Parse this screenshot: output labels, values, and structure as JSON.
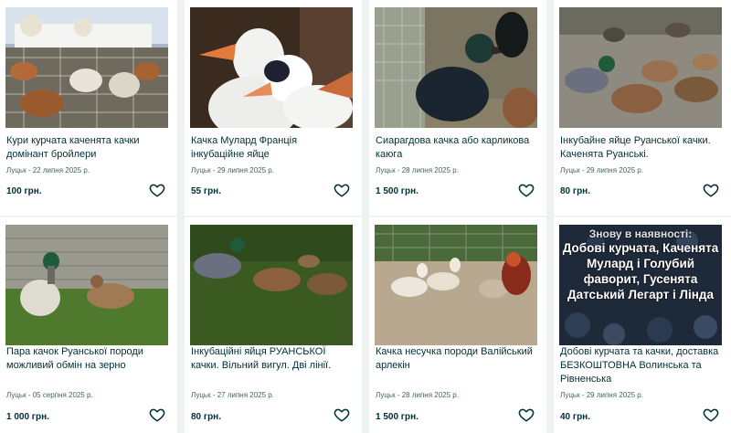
{
  "listings": [
    {
      "title": "Кури курчата каченята качки домінант бройлери",
      "location": "Луцьк",
      "date": "22 липня 2025 р.",
      "price": "100 грн.",
      "image": "chickens-in-cage-photo"
    },
    {
      "title": "Качка Мулард Франція інкубаційне яйце",
      "location": "Луцьк",
      "date": "29 липня 2025 р.",
      "price": "55 грн.",
      "image": "white-mulard-ducks-photo"
    },
    {
      "title": "Сиарагдова качка або карликова каюга",
      "location": "Луцьк",
      "date": "28 липня 2025 р.",
      "price": "1 500 грн.",
      "image": "emerald-duck-photo"
    },
    {
      "title": "Інкубайне яйце Руанської качки. Каченята Руанські.",
      "location": "Луцьк",
      "date": "29 липня 2025 р.",
      "price": "80 грн.",
      "image": "rouen-ducks-flock-photo"
    },
    {
      "title": "Пара качок Руанської породи можливий обмін на зерно",
      "location": "Луцьк",
      "date": "05 серпня 2025 р.",
      "price": "1 000 грн.",
      "image": "rouen-duck-pair-photo"
    },
    {
      "title": "Інкубаційні яйця РУАНСЬКОЇ качки. Вільний вигул. Дві лінії.",
      "location": "Луцьк",
      "date": "27 липня 2025 р.",
      "price": "80 грн.",
      "image": "ducks-on-grass-photo"
    },
    {
      "title": "Качка несучка породи Валійський арлекін",
      "location": "Луцьк",
      "date": "28 липня 2025 р.",
      "price": "1 500 грн.",
      "image": "welsh-harlequin-ducks-photo"
    },
    {
      "title": "Добові курчата та качки, доставка БЕЗКОШТОВНА Волинська та Рівненська",
      "location": "Луцьк",
      "date": "29 липня 2025 р.",
      "price": "40 грн.",
      "image": "promo-banner-photo",
      "image_text": {
        "top": "Знову в наявності:",
        "body": "Добові курчата, Каченята Мулард і Голубий фаворит, Гусенята Датський Легарт і Лінда"
      }
    }
  ],
  "icons": {
    "favorite": "heart-outline-icon"
  },
  "colors": {
    "background": "#eef2f1",
    "card": "#ffffff",
    "text": "#002f34",
    "meta": "#406367"
  }
}
